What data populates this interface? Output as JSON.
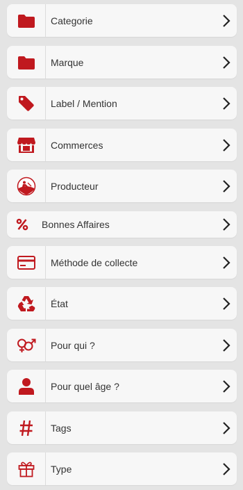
{
  "theme": {
    "accent": "#c0191f",
    "chevron": "#222222",
    "row_bg": "#f7f7f7",
    "page_bg": "#e4e4e4"
  },
  "items": [
    {
      "label": "Categorie",
      "icon": "folder-icon"
    },
    {
      "label": "Marque",
      "icon": "folder-icon"
    },
    {
      "label": "Label / Mention",
      "icon": "tag-icon"
    },
    {
      "label": "Commerces",
      "icon": "store-icon"
    },
    {
      "label": "Producteur",
      "icon": "producer-icon"
    },
    {
      "label": "Bonnes Affaires",
      "icon": "percent-icon"
    },
    {
      "label": "Méthode de collecte",
      "icon": "credit-card-icon"
    },
    {
      "label": "État",
      "icon": "recycle-icon"
    },
    {
      "label": "Pour qui ?",
      "icon": "gender-icon"
    },
    {
      "label": "Pour quel âge ?",
      "icon": "user-icon"
    },
    {
      "label": "Tags",
      "icon": "hashtag-icon"
    },
    {
      "label": "Type",
      "icon": "gift-icon"
    }
  ]
}
